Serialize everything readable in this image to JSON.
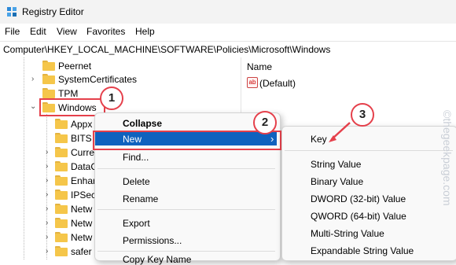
{
  "window": {
    "title": "Registry Editor"
  },
  "menu": [
    "File",
    "Edit",
    "View",
    "Favorites",
    "Help"
  ],
  "address": "Computer\\HKEY_LOCAL_MACHINE\\SOFTWARE\\Policies\\Microsoft\\Windows",
  "tree": [
    {
      "label": "Peernet"
    },
    {
      "label": "SystemCertificates"
    },
    {
      "label": "TPM"
    },
    {
      "label": "Windows"
    },
    {
      "label": "Appx"
    },
    {
      "label": "BITS"
    },
    {
      "label": "Curre"
    },
    {
      "label": "DataC"
    },
    {
      "label": "Enhar"
    },
    {
      "label": "IPSec"
    },
    {
      "label": "Netw"
    },
    {
      "label": "Netw"
    },
    {
      "label": "Netw"
    },
    {
      "label": "safer"
    }
  ],
  "right_pane": {
    "column_header": "Name",
    "default_value": "(Default)",
    "default_icon_text": "ab"
  },
  "context_menu": {
    "items": [
      "Collapse",
      "New",
      "Find...",
      "Delete",
      "Rename",
      "Export",
      "Permissions...",
      "Copy Key Name"
    ],
    "arrow": "›"
  },
  "submenu": {
    "items": [
      "Key",
      "String Value",
      "Binary Value",
      "DWORD (32-bit) Value",
      "QWORD (64-bit) Value",
      "Multi-String Value",
      "Expandable String Value"
    ]
  },
  "annotations": {
    "badge1": "1",
    "badge2": "2",
    "badge3": "3",
    "accent": "#e5404b"
  },
  "watermark": "©thegeekpage.com"
}
